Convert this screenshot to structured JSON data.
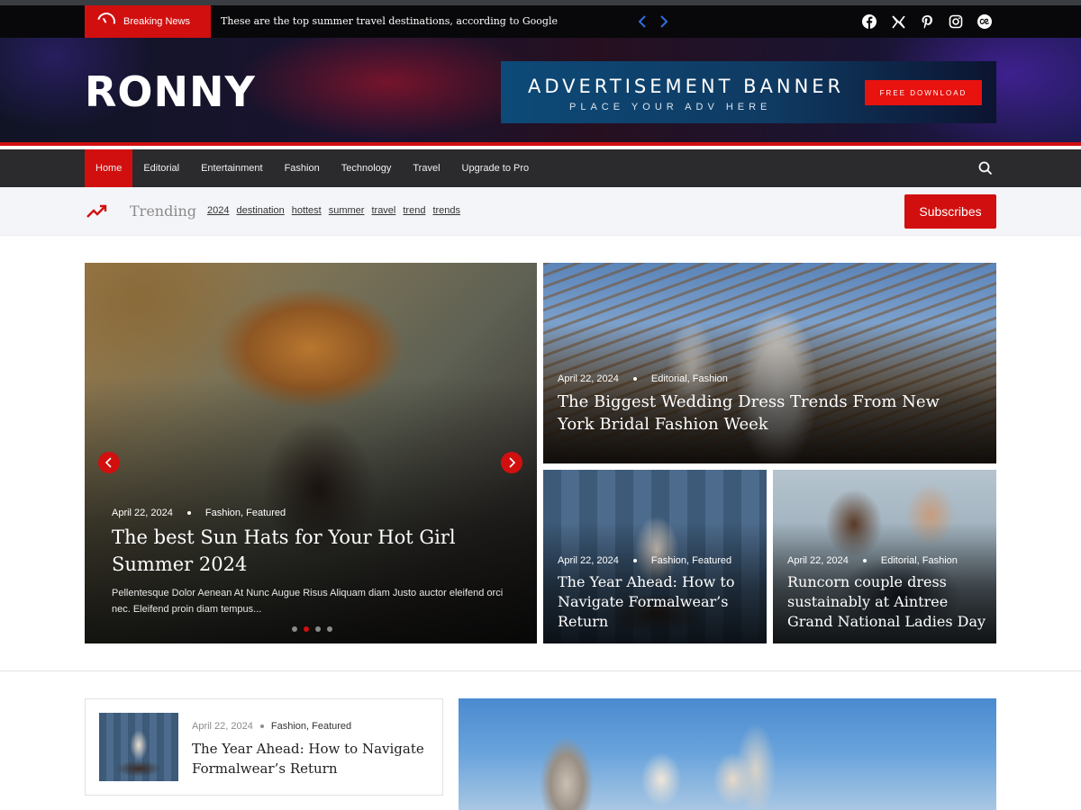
{
  "topbar": {
    "breaking_label": "Breaking News",
    "breaking_text": "These are the top summer travel destinations, according to Google",
    "social": [
      "facebook-icon",
      "x-twitter-icon",
      "pinterest-icon",
      "instagram-icon",
      "lastfm-icon"
    ]
  },
  "header": {
    "logo": "RONNY",
    "ad_title": "ADVERTISEMENT BANNER",
    "ad_subtitle": "PLACE YOUR ADV HERE",
    "ad_button": "FREE DOWNLOAD"
  },
  "nav": {
    "items": [
      "Home",
      "Editorial",
      "Entertainment",
      "Fashion",
      "Technology",
      "Travel",
      "Upgrade to Pro"
    ],
    "active": "Home"
  },
  "trending": {
    "label": "Trending",
    "tags": [
      "2024",
      "destination",
      "hottest",
      "summer",
      "travel",
      "trend",
      "trends"
    ],
    "subscribe": "Subscribes"
  },
  "featured": {
    "main": {
      "date": "April 22, 2024",
      "categories": "Fashion, Featured",
      "title": "The best Sun Hats for Your Hot Girl Summer 2024",
      "excerpt": "Pellentesque Dolor Aenean At Nunc Augue Risus Aliquam diam Justo auctor eleifend orci nec. Eleifend proin diam tempus..."
    },
    "wedding": {
      "date": "April 22, 2024",
      "categories": "Editorial, Fashion",
      "title": "The Biggest Wedding Dress Trends From New York Bridal Fashion Week"
    },
    "formal": {
      "date": "April 22, 2024",
      "categories": "Fashion, Featured",
      "title": "The Year Ahead: How to Navigate Formalwear’s Return"
    },
    "couple": {
      "date": "April 22, 2024",
      "categories": "Editorial, Fashion",
      "title": "Runcorn couple dress sustainably at Aintree Grand National Ladies Day"
    }
  },
  "list": {
    "date": "April 22, 2024",
    "categories": "Fashion, Featured",
    "title": "The Year Ahead: How to Navigate Formalwear’s Return"
  },
  "colors": {
    "accent": "#d10f0f",
    "nav_bg": "#2b2b2d",
    "topbar_bg": "#08080a"
  }
}
